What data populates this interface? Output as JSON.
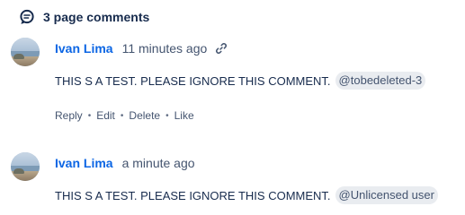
{
  "header": {
    "icon": "comments-icon",
    "title": "3 page comments"
  },
  "comments": [
    {
      "author": "Ivan Lima",
      "time": "11 minutes ago",
      "text": "THIS S A TEST. PLEASE IGNORE THIS COMMENT.",
      "mention": "@tobedeleted-3",
      "has_link_icon": true,
      "actions": [
        "Reply",
        "Edit",
        "Delete",
        "Like"
      ]
    },
    {
      "author": "Ivan Lima",
      "time": "a minute ago",
      "text": "THIS S A TEST. PLEASE IGNORE THIS COMMENT.",
      "mention": "@Unlicensed user"
    }
  ],
  "colors": {
    "author": "#0c66e4",
    "text": "#172b4d",
    "muted": "#44546f",
    "mention_bg": "#e9ecf0"
  }
}
